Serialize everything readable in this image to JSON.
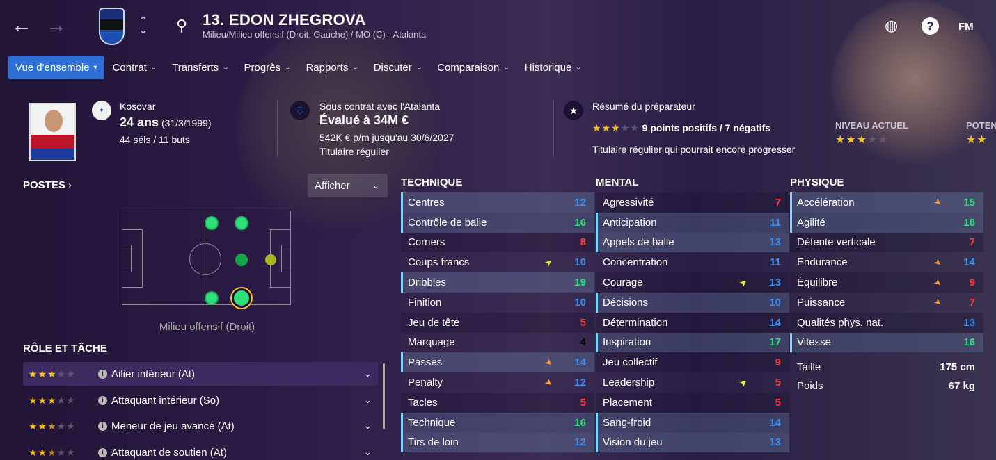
{
  "header": {
    "number_name": "13. EDON ZHEGROVA",
    "subtitle": "Milieu/Milieu offensif (Droit, Gauche) / MO (C) - Atalanta",
    "fm_label": "FM",
    "help_label": "?"
  },
  "tabs": [
    {
      "label": "Vue d'ensemble",
      "active": true
    },
    {
      "label": "Contrat"
    },
    {
      "label": "Transferts"
    },
    {
      "label": "Progrès"
    },
    {
      "label": "Rapports"
    },
    {
      "label": "Discuter"
    },
    {
      "label": "Comparaison"
    },
    {
      "label": "Historique"
    }
  ],
  "summary": {
    "nationality": "Kosovar",
    "age": "24 ans",
    "dob": "(31/3/1999)",
    "caps": "44 séls / 11 buts",
    "contract_title": "Sous contrat avec l'Atalanta",
    "value": "Évalué à 34M €",
    "wage": "542K € p/m jusqu'au 30/6/2027",
    "status": "Titulaire régulier",
    "coach_title": "Résumé du préparateur",
    "coach_stars": 3,
    "coach_points": "9 points positifs / 7 négatifs",
    "coach_text": "Titulaire régulier qui pourrait encore progresser",
    "current_label": "NIVEAU ACTUEL",
    "current_stars": 3,
    "potential_label": "POTEN"
  },
  "positions": {
    "title": "POSTES",
    "afficher": "Afficher",
    "selected_label": "Milieu offensif (Droit)"
  },
  "roles": {
    "title": "RÔLE ET TÂCHE",
    "items": [
      {
        "name": "Ailier intérieur (At)",
        "stars": 3
      },
      {
        "name": "Attaquant intérieur (So)",
        "stars": 3
      },
      {
        "name": "Meneur de jeu avancé (At)",
        "stars": 2.5
      },
      {
        "name": "Attaquant de soutien (At)",
        "stars": 2.5
      }
    ]
  },
  "colors": {
    "high": "#2ee07a",
    "mid": "#3a8ef0",
    "low": "#ff3b3b",
    "accent": "#2f6fd6"
  },
  "technique": {
    "title": "TECHNIQUE",
    "items": [
      {
        "name": "Centres",
        "value": "12",
        "hl": true
      },
      {
        "name": "Contrôle de balle",
        "value": "16",
        "hl": true
      },
      {
        "name": "Corners",
        "value": "8"
      },
      {
        "name": "Coups francs",
        "value": "10",
        "trend": "up"
      },
      {
        "name": "Dribbles",
        "value": "19",
        "hl": true
      },
      {
        "name": "Finition",
        "value": "10"
      },
      {
        "name": "Jeu de tête",
        "value": "5"
      },
      {
        "name": "Marquage",
        "value": "4"
      },
      {
        "name": "Passes",
        "value": "14",
        "hl": true,
        "trend": "down"
      },
      {
        "name": "Penalty",
        "value": "12",
        "trend": "down"
      },
      {
        "name": "Tacles",
        "value": "5"
      },
      {
        "name": "Technique",
        "value": "16",
        "hl": true
      },
      {
        "name": "Tirs de loin",
        "value": "12",
        "hl": true
      }
    ]
  },
  "mental": {
    "title": "MENTAL",
    "items": [
      {
        "name": "Agressivité",
        "value": "7"
      },
      {
        "name": "Anticipation",
        "value": "11",
        "hl": true
      },
      {
        "name": "Appels de balle",
        "value": "13",
        "hl": true
      },
      {
        "name": "Concentration",
        "value": "11"
      },
      {
        "name": "Courage",
        "value": "13",
        "trend": "up"
      },
      {
        "name": "Décisions",
        "value": "10",
        "hl": true
      },
      {
        "name": "Détermination",
        "value": "14"
      },
      {
        "name": "Inspiration",
        "value": "17",
        "hl": true
      },
      {
        "name": "Jeu collectif",
        "value": "9"
      },
      {
        "name": "Leadership",
        "value": "5",
        "trend": "up"
      },
      {
        "name": "Placement",
        "value": "5"
      },
      {
        "name": "Sang-froid",
        "value": "14",
        "hl": true
      },
      {
        "name": "Vision du jeu",
        "value": "13",
        "hl": true
      }
    ]
  },
  "physique": {
    "title": "PHYSIQUE",
    "items": [
      {
        "name": "Accélération",
        "value": "15",
        "hl": true,
        "trend": "down"
      },
      {
        "name": "Agilité",
        "value": "18",
        "hl": true
      },
      {
        "name": "Détente verticale",
        "value": "7"
      },
      {
        "name": "Endurance",
        "value": "14",
        "trend": "down"
      },
      {
        "name": "Équilibre",
        "value": "9",
        "trend": "down"
      },
      {
        "name": "Puissance",
        "value": "7",
        "trend": "down"
      },
      {
        "name": "Qualités phys. nat.",
        "value": "13"
      },
      {
        "name": "Vitesse",
        "value": "16",
        "hl": true
      }
    ],
    "height_label": "Taille",
    "height": "175 cm",
    "weight_label": "Poids",
    "weight": "67 kg"
  }
}
